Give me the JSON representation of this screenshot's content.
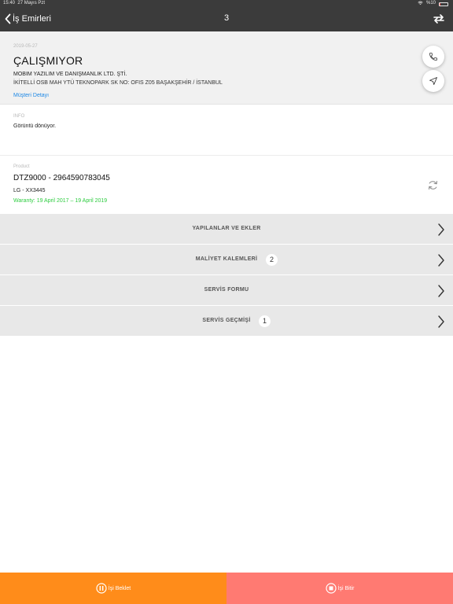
{
  "status_bar": {
    "time": "15:40",
    "date": "27 Mayıs Pzt",
    "battery": "%10"
  },
  "nav": {
    "back_label": "İş Emirleri",
    "title": "3"
  },
  "customer": {
    "date": "2019-05-27",
    "title": "ÇALIŞMIYOR",
    "company": "MOBIM YAZILIM VE DANIŞMANLIK LTD. ŞTİ.",
    "address": "İKİTELLİ OSB MAH YTÜ TEKNOPARK SK NO: OFIS Z05 BAŞAKŞEHİR / İSTANBUL",
    "detail_link": "Müşteri Detayı"
  },
  "info": {
    "label": "INFO",
    "text": "Görüntü dönüyor."
  },
  "product": {
    "label": "Product",
    "serial": "DTZ9000 - 2964590783045",
    "model": "LG - XX3445",
    "warranty": "Waranty: 19 April 2017 – 19 April 2019"
  },
  "menu": [
    {
      "label": "YAPILANLAR VE EKLER",
      "badge": ""
    },
    {
      "label": "MALİYET KALEMLERİ",
      "badge": "2"
    },
    {
      "label": "SERVİS FORMU",
      "badge": ""
    },
    {
      "label": "SERVİS GEÇMİŞİ",
      "badge": "1"
    }
  ],
  "actions": {
    "wait_label": "İşi Beklet",
    "finish_label": "İşi Bitir"
  },
  "colors": {
    "navbar": "#3b3b3b",
    "wait": "#ff8c1a",
    "finish": "#ff7a72",
    "link": "#1e88e5",
    "warranty": "#2ecc40"
  },
  "icons": [
    "chevron-left-icon",
    "sync-icon",
    "phone-icon",
    "navigation-icon",
    "refresh-icon",
    "chevron-right-icon",
    "pause-circle-icon",
    "stop-circle-icon",
    "wifi-icon",
    "battery-icon"
  ]
}
